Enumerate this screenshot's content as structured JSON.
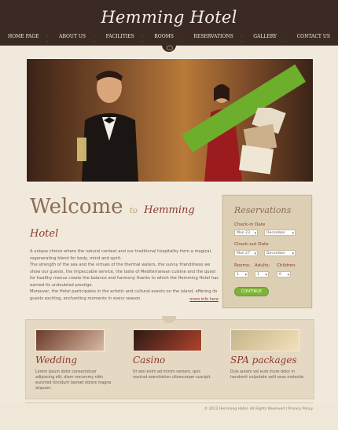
{
  "header": {
    "brand": "Hemming Hotel",
    "nav": [
      "HOME PAGE",
      "ABOUT US",
      "FACILITIES",
      "ROOMS",
      "RESERVATIONS",
      "GALLERY",
      "CONTACT US"
    ]
  },
  "welcome": {
    "title": "Welcome",
    "to": "to",
    "name": "Hemming Hotel",
    "text": [
      "A unique choice where the natural context and our traditional hospitality form a magical, regenerating blend for body, mind and spirit.",
      "The strength of the sea and the virtues of the thermal waters, the sunny friendliness we show our guests, the impeccable service, the taste of Mediterranean cuisine and the quest for healthy menus create the balance and harmony thanks to which the Hemming Hotel has earned its undoubted prestige.",
      "Moreover, the Hotel participates in the artistic and cultural events on the island, offering its guests exciting, enchanting moments in every season."
    ],
    "more": "more info here"
  },
  "reservations": {
    "title": "Reservations",
    "checkin_label": "Check-in Date",
    "checkin_day": "Mon 23",
    "checkin_month": "December",
    "checkout_label": "Check-out Date",
    "checkout_day": "Mon 27",
    "checkout_month": "December",
    "rooms_label": "Rooms:",
    "rooms_value": "1",
    "adults_label": "Adults:",
    "adults_value": "1",
    "children_label": "Children:",
    "children_value": "0",
    "button": "CONTINUE"
  },
  "cards": [
    {
      "title": "Wedding",
      "text": "Lorem ipsum dolor consectetuer adipiscing elit, diam nonummy nibh euismod tincidunt laoreet dolore magna aliquam."
    },
    {
      "title": "Casino",
      "text": "Ut wisi enim ad minim veniam, quis nostrud exercitation ullamcorper suscipit."
    },
    {
      "title": "SPA packages",
      "text": "Duis autem vel eum iriure dolor in hendrerit vulputate velit esse molestie."
    }
  ],
  "footer": {
    "copyright": "© 2012 Hemming Hotel. All Rights Reserved  |  Privacy Policy"
  }
}
